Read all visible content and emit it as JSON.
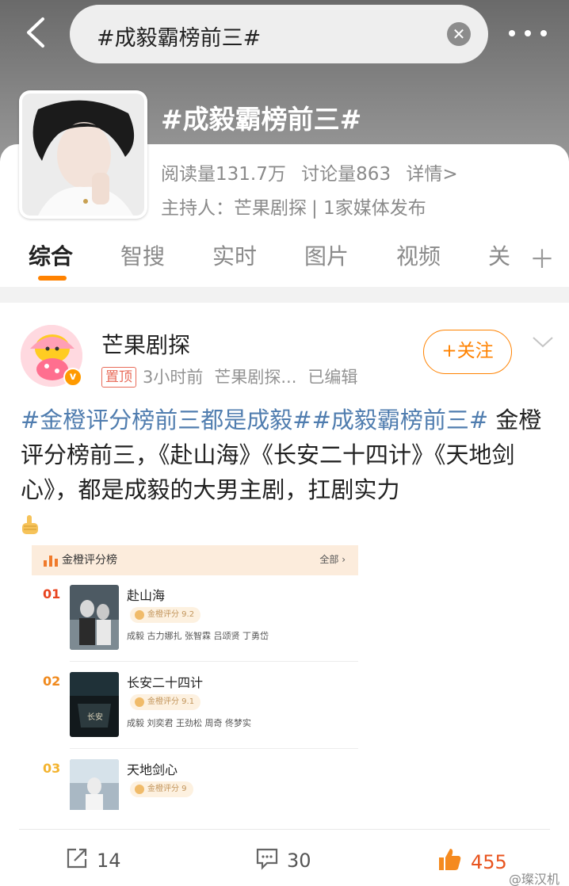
{
  "search": {
    "query": "#成毅霸榜前三#"
  },
  "topic": {
    "title": "#成毅霸榜前三#",
    "reads": "阅读量131.7万",
    "discussions": "讨论量863",
    "details_link": "详情>",
    "host": "主持人：芒果剧探",
    "media": "| 1家媒体发布"
  },
  "tabs": [
    "综合",
    "智搜",
    "实时",
    "图片",
    "视频",
    "关"
  ],
  "post": {
    "author": "芒果剧探",
    "pin_label": "置顶",
    "time": "3小时前",
    "source": "芒果剧探...",
    "edited": "已编辑",
    "follow_label": "+关注",
    "hashtag1": "#金橙评分榜前三都是成毅#",
    "hashtag2": "#成毅霸榜前三#",
    "body": " 金橙评分榜前三，《赴山海》《长安二十四计》《天地剑心》，都是成毅的大男主剧，扛剧实力"
  },
  "ranking": {
    "title": "金橙评分榜",
    "all_label": "全部 ›",
    "items": [
      {
        "rank": "01",
        "title": "赴山海",
        "score": "金橙评分 9.2",
        "cast": "成毅   古力娜扎   张智霖   吕颂贤   丁勇岱",
        "rank_color": "#e8441f"
      },
      {
        "rank": "02",
        "title": "长安二十四计",
        "score": "金橙评分 9.1",
        "cast": "成毅   刘奕君   王劲松   周奇   佟梦实",
        "rank_color": "#f08a1e"
      },
      {
        "rank": "03",
        "title": "天地剑心",
        "score": "金橙评分 9",
        "cast": "",
        "rank_color": "#f3b32e"
      }
    ]
  },
  "actions": {
    "shares": "14",
    "comments": "30",
    "likes": "455"
  },
  "watermark": "@璨汉机"
}
